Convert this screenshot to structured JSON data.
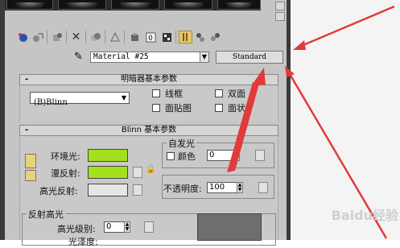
{
  "toolbar": {
    "icons": [
      "get-material-icon",
      "put-material-icon",
      "assign-material-icon",
      "reset-icon",
      "copy-material-icon",
      "make-unique-icon",
      "put-library-icon",
      "material-effects-icon",
      "show-map-icon",
      "show-end-result-icon",
      "go-to-parent-icon",
      "go-forward-icon",
      "pick-material-icon"
    ]
  },
  "material": {
    "name": "Material #25",
    "type_button": "Standard"
  },
  "shader_rollout": {
    "title": "明暗器基本参数",
    "shader": "(B)Blinn",
    "wire": "线框",
    "two_sided": "双面",
    "face_map": "面贴图",
    "faceted": "面状"
  },
  "blinn_rollout": {
    "title": "Blinn 基本参数",
    "ambient_label": "环境光:",
    "diffuse_label": "漫反射:",
    "specular_label": "高光反射:",
    "ambient_color": "#a4e01e",
    "diffuse_color": "#a4e01e",
    "specular_color": "#e6e6e6",
    "self_illum_group": "自发光",
    "color_label": "颜色",
    "self_illum_value": "0",
    "opacity_label": "不透明度:",
    "opacity_value": "100",
    "spec_highlights_group": "反射高光",
    "spec_level_label": "高光级别:",
    "spec_level_value": "0",
    "glossiness_label": "光泽度:"
  },
  "watermark": "Baidu经验",
  "colors": {
    "arrow_red": "#e23a3a",
    "panel_gray": "#c5c5c5"
  }
}
